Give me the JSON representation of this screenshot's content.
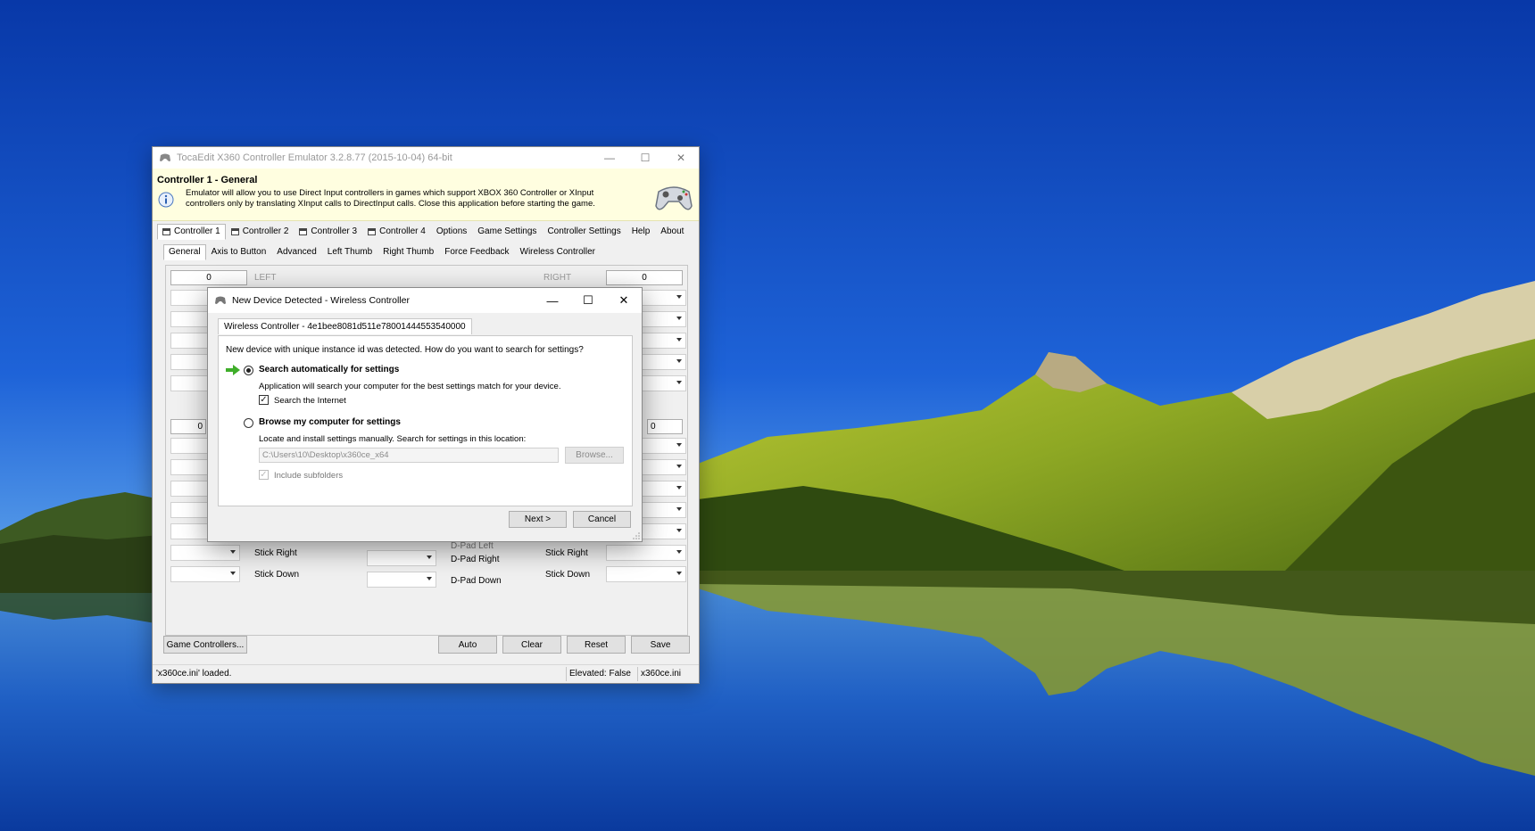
{
  "main_window": {
    "title": "TocaEdit X360 Controller Emulator 3.2.8.77 (2015-10-04) 64-bit",
    "header_title": "Controller 1 - General",
    "header_desc": "Emulator will allow you to use Direct Input controllers in games which support XBOX 360 Controller or XInput controllers only by translating XInput calls to DirectInput calls. Close this application before starting the game.",
    "tabs": [
      "Controller 1",
      "Controller 2",
      "Controller 3",
      "Controller 4",
      "Options",
      "Game Settings",
      "Controller Settings",
      "Help",
      "About"
    ],
    "subtabs": [
      "General",
      "Axis to Button",
      "Advanced",
      "Left Thumb",
      "Right Thumb",
      "Force Feedback",
      "Wireless Controller"
    ],
    "left_value": "0",
    "left_label": "LEFT",
    "right_value": "0",
    "right_label": "RIGHT",
    "mid_left_fragment": "0",
    "mid_right_fragment": "0",
    "labels": {
      "stick_right_left": "Stick Right",
      "stick_down_left": "Stick Down",
      "dpad_left": "D-Pad Left",
      "dpad_right": "D-Pad Right",
      "dpad_down": "D-Pad Down",
      "stick_right_right": "Stick Right",
      "stick_down_right": "Stick Down"
    },
    "buttons": {
      "game_controllers": "Game Controllers...",
      "auto": "Auto",
      "clear": "Clear",
      "reset": "Reset",
      "save": "Save"
    },
    "status": {
      "message": "'x360ce.ini' loaded.",
      "elevated": "Elevated: False",
      "file": "x360ce.ini"
    }
  },
  "dialog": {
    "title": "New Device Detected - Wireless Controller",
    "tab": "Wireless Controller - 4e1bee8081d511e78001444553540000",
    "question": "New device with unique instance id was detected. How do you want to search for settings?",
    "option_auto": "Search automatically for settings",
    "option_auto_desc": "Application will search your computer for the best settings match for your device.",
    "search_internet": "Search the Internet",
    "option_browse": "Browse my computer for settings",
    "option_browse_desc": "Locate and install settings manually. Search for settings in this location:",
    "path_value": "C:\\Users\\10\\Desktop\\x360ce_x64",
    "browse_button": "Browse...",
    "include_subfolders": "Include subfolders",
    "next_button": "Next >",
    "cancel_button": "Cancel",
    "selected_option": "auto"
  },
  "colors": {
    "sky_top": "#0a3fb5",
    "sky_bottom": "#5aa7ee",
    "header_bg": "#fffee0",
    "arrow_green": "#3fae2a"
  }
}
